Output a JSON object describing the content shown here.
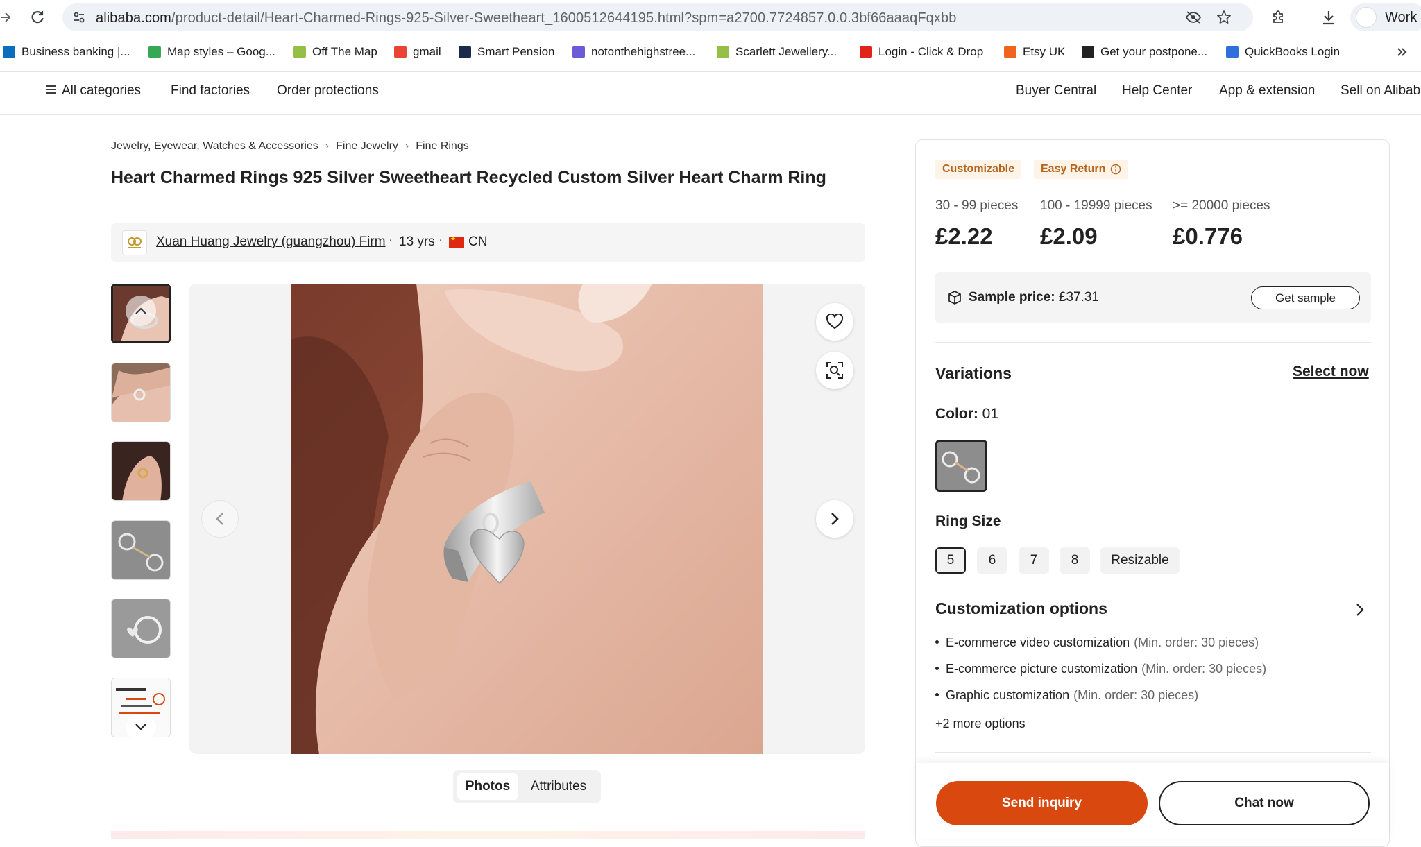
{
  "browser": {
    "url_host": "alibaba.com",
    "url_path": "/product-detail/Heart-Charmed-Rings-925-Silver-Sweetheart_1600512644195.html?spm=a2700.7724857.0.0.3bf66aaaqFqxbb",
    "profile_label": "Work",
    "bookmarks": [
      {
        "label": "Business banking |...",
        "color": "#0a6ebd"
      },
      {
        "label": "Map styles – Goog...",
        "color": "#34a853"
      },
      {
        "label": "Off The Map",
        "color": "#95bf47"
      },
      {
        "label": "gmail",
        "color": "#ea4335"
      },
      {
        "label": "Smart Pension",
        "color": "#1b2a4a"
      },
      {
        "label": "notonthehighstree...",
        "color": "#6b5bd6"
      },
      {
        "label": "Scarlett Jewellery...",
        "color": "#95bf47"
      },
      {
        "label": "Login - Click & Drop",
        "color": "#e2231a"
      },
      {
        "label": "Etsy UK",
        "color": "#f1641e"
      },
      {
        "label": "Get your postpone...",
        "color": "#222222"
      },
      {
        "label": "QuickBooks Login",
        "color": "#2f6fdb"
      }
    ]
  },
  "site_nav": {
    "all_categories": "All categories",
    "find_factories": "Find factories",
    "order_protections": "Order protections",
    "buyer_central": "Buyer Central",
    "help_center": "Help Center",
    "app_extension": "App & extension",
    "sell_on": "Sell on Alibaba"
  },
  "breadcrumb": [
    "Jewelry, Eyewear, Watches & Accessories",
    "Fine Jewelry",
    "Fine Rings"
  ],
  "product": {
    "title": "Heart Charmed Rings 925 Silver Sweetheart Recycled Custom Silver Heart Charm Ring"
  },
  "supplier": {
    "name": "Xuan Huang Jewelry (guangzhou) Firm",
    "years": "13 yrs",
    "country": "CN"
  },
  "media_tabs": {
    "photos": "Photos",
    "attributes": "Attributes"
  },
  "tags": {
    "customizable": "Customizable",
    "easy_return": "Easy Return"
  },
  "price_tiers": [
    {
      "range": "30 - 99 pieces",
      "price": "£2.22"
    },
    {
      "range": "100 - 19999 pieces",
      "price": "£2.09"
    },
    {
      "range": ">= 20000 pieces",
      "price": "£0.776"
    }
  ],
  "sample": {
    "label": "Sample price:",
    "price": "£37.31",
    "button": "Get sample"
  },
  "variations": {
    "title": "Variations",
    "select_now": "Select now",
    "color_label": "Color:",
    "color_value": "01",
    "ring_size_title": "Ring Size",
    "sizes": [
      "5",
      "6",
      "7",
      "8",
      "Resizable"
    ]
  },
  "customization": {
    "title": "Customization options",
    "items": [
      {
        "name": "E-commerce video customization",
        "min": "(Min. order: 30 pieces)"
      },
      {
        "name": "E-commerce picture customization",
        "min": "(Min. order: 30 pieces)"
      },
      {
        "name": "Graphic customization",
        "min": "(Min. order: 30 pieces)"
      }
    ],
    "more": "+2 more options"
  },
  "actions": {
    "send_inquiry": "Send inquiry",
    "chat_now": "Chat now"
  },
  "colors": {
    "accent": "#d9480f",
    "tag_bg": "#fdf3e7",
    "tag_text": "#b5651d"
  }
}
